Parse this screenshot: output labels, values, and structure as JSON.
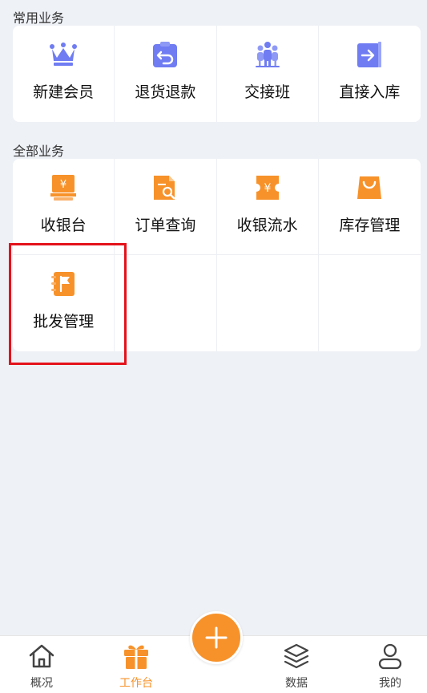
{
  "common_section": {
    "title": "常用业务",
    "items": [
      {
        "label": "新建会员",
        "icon": "crown-icon"
      },
      {
        "label": "退货退款",
        "icon": "return-clipboard-icon"
      },
      {
        "label": "交接班",
        "icon": "group-people-icon"
      },
      {
        "label": "直接入库",
        "icon": "stock-in-icon"
      }
    ]
  },
  "all_section": {
    "title": "全部业务",
    "items": [
      {
        "label": "收银台",
        "icon": "cash-register-icon"
      },
      {
        "label": "订单查询",
        "icon": "order-search-icon"
      },
      {
        "label": "收银流水",
        "icon": "cash-ticket-icon"
      },
      {
        "label": "库存管理",
        "icon": "shopping-bag-icon"
      },
      {
        "label": "批发管理",
        "icon": "wholesale-notebook-icon"
      }
    ]
  },
  "tabbar": {
    "items": [
      {
        "label": "概况",
        "icon": "home-icon",
        "active": false
      },
      {
        "label": "工作台",
        "icon": "gift-icon",
        "active": true
      },
      {
        "label": "数据",
        "icon": "layers-icon",
        "active": false
      },
      {
        "label": "我的",
        "icon": "user-icon",
        "active": false
      }
    ],
    "fab_icon": "plus-icon"
  },
  "colors": {
    "accent": "#f7922a",
    "icon_purple": "#6f7cf2",
    "icon_orange": "#f7922a",
    "highlight": "#e4121b",
    "background": "#eef1f6"
  }
}
